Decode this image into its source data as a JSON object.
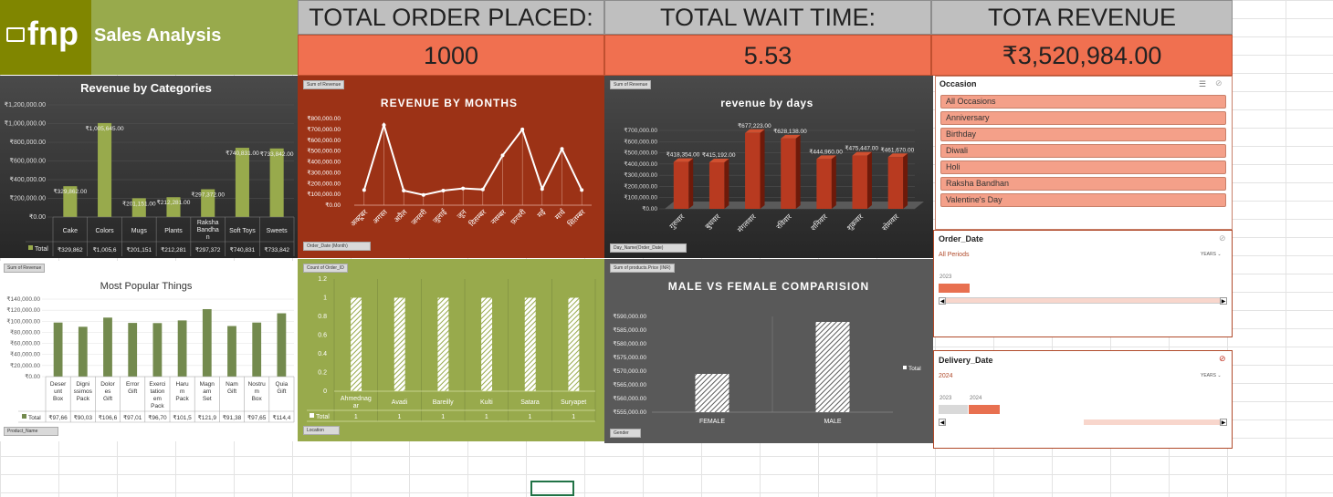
{
  "logo": {
    "brand": "fnp",
    "title": "Sales Analysis"
  },
  "kpis": [
    {
      "title": "TOTAL ORDER PLACED:",
      "value": "1000"
    },
    {
      "title": "TOTAL WAIT TIME:",
      "value": "5.53"
    },
    {
      "title": "TOTA REVENUE",
      "value": "₹3,520,984.00"
    }
  ],
  "colors": {
    "olive": "#98aa4c",
    "darkolive": "#808600",
    "orange": "#f07050",
    "rust": "#9c3216",
    "charcoal": "#3a3a3a"
  },
  "chart_data": [
    {
      "type": "bar",
      "title": "Revenue by Categories",
      "categories": [
        "Cake",
        "Colors",
        "Mugs",
        "Plants",
        "Raksha Bandhan",
        "Soft Toys",
        "Sweets"
      ],
      "series": [
        {
          "name": "Total",
          "values": [
            329862,
            1005645,
            201151,
            212281,
            297372,
            740831,
            733842
          ]
        }
      ],
      "data_labels": [
        "₹329,862.00",
        "₹1,005,645.00",
        "₹201,151.00",
        "₹212,281.00",
        "₹297,372.00",
        "₹740,831.00",
        "₹733,842.00"
      ],
      "table_row": [
        "₹329,862",
        "₹1,005,6",
        "₹201,151",
        "₹212,281",
        "₹297,372",
        "₹740,831",
        "₹733,842"
      ],
      "y_ticks": [
        "₹1,200,000.00",
        "₹1,000,000.00",
        "₹800,000.00",
        "₹600,000.00",
        "₹400,000.00",
        "₹200,000.00",
        "₹0.00"
      ],
      "ylim": [
        0,
        1200000
      ]
    },
    {
      "type": "line",
      "title": "REVENUE BY MONTHS",
      "field_button": "Sum of Revenue",
      "axis_button": "Order_Date (Month)",
      "categories": [
        "अक्टूबर",
        "अगस्त",
        "अप्रैल",
        "जनवरी",
        "जुलाई",
        "जून",
        "दिसम्बर",
        "नवम्बर",
        "फ़रवरी",
        "मई",
        "मार्च",
        "सितम्बर"
      ],
      "values": [
        140000,
        740000,
        135000,
        95000,
        135000,
        155000,
        145000,
        460000,
        700000,
        150000,
        520000,
        140000
      ],
      "y_ticks": [
        "₹800,000.00",
        "₹700,000.00",
        "₹600,000.00",
        "₹500,000.00",
        "₹400,000.00",
        "₹300,000.00",
        "₹200,000.00",
        "₹100,000.00",
        "₹0.00"
      ],
      "ylim": [
        0,
        800000
      ]
    },
    {
      "type": "bar",
      "title": "revenue by days",
      "field_button": "Sum of Revenue",
      "axis_button": "Day_Name(Order_Date)",
      "categories": [
        "गुरुवार",
        "बुधवार",
        "मंगलवार",
        "रविवार",
        "शनिवार",
        "शुक्रवार",
        "सोमवार"
      ],
      "values": [
        418354,
        415192,
        677223,
        628138,
        444960,
        475447,
        461670
      ],
      "data_labels": [
        "₹418,354.00",
        "₹415,192.00",
        "₹677,223.00",
        "₹628,138.00",
        "₹444,960.00",
        "₹475,447.00",
        "₹461,670.00"
      ],
      "y_ticks": [
        "₹700,000.00",
        "₹600,000.00",
        "₹500,000.00",
        "₹400,000.00",
        "₹300,000.00",
        "₹200,000.00",
        "₹100,000.00",
        "₹0.00"
      ],
      "ylim": [
        0,
        700000
      ]
    },
    {
      "type": "bar",
      "title": "Most Popular Things",
      "field_button": "Sum of Revenue",
      "axis_button": "Product_Name",
      "categories": [
        "Desert unt Box",
        "Dignissimos Pack",
        "Dolores Gift",
        "Error Gift",
        "Exercitationem Pack",
        "Harum Pack",
        "Magnam Set",
        "Nam Gift",
        "Nostrum Box",
        "Quia Gift"
      ],
      "category_cells": [
        "Deser unt Box",
        "Digni ssimos Pack",
        "Dolor es Gift",
        "Error Gift",
        "Exerci tation em Pack",
        "Haru m Pack",
        "Magn am Set",
        "Nam Gift",
        "Nostru m Box",
        "Quia Gift"
      ],
      "series": [
        {
          "name": "Total",
          "values": [
            97660,
            90030,
            106600,
            97010,
            96700,
            101500,
            121900,
            91380,
            97650,
            114400
          ]
        }
      ],
      "table_row": [
        "₹97,66",
        "₹90,03",
        "₹106,6",
        "₹97,01",
        "₹96,70",
        "₹101,5",
        "₹121,9",
        "₹91,38",
        "₹97,65",
        "₹114,4"
      ],
      "y_ticks": [
        "₹140,000.00",
        "₹120,000.00",
        "₹100,000.00",
        "₹80,000.00",
        "₹60,000.00",
        "₹40,000.00",
        "₹20,000.00",
        "₹0.00"
      ],
      "ylim": [
        0,
        140000
      ]
    },
    {
      "type": "bar",
      "field_button": "Count of Order_ID",
      "axis_button": "Location",
      "categories": [
        "Ahmednagar",
        "Avadi",
        "Bareilly",
        "Kulti",
        "Satara",
        "Suryapet"
      ],
      "category_cells": [
        "Ahmednag ar",
        "Avadi",
        "Bareilly",
        "Kulti",
        "Satara",
        "Suryapet"
      ],
      "series": [
        {
          "name": "Total",
          "values": [
            1,
            1,
            1,
            1,
            1,
            1
          ]
        }
      ],
      "table_row": [
        "1",
        "1",
        "1",
        "1",
        "1",
        "1"
      ],
      "y_ticks": [
        "1.2",
        "1",
        "0.8",
        "0.6",
        "0.4",
        "0.2",
        "0"
      ],
      "ylim": [
        0,
        1.2
      ]
    },
    {
      "type": "bar",
      "title": "MALE VS FEMALE COMPARISION",
      "field_button": "Sum of products.Price (INR)",
      "axis_button": "Gender",
      "legend": "Total",
      "categories": [
        "FEMALE",
        "MALE"
      ],
      "values": [
        569000,
        588000
      ],
      "y_ticks": [
        "₹590,000.00",
        "₹585,000.00",
        "₹580,000.00",
        "₹575,000.00",
        "₹570,000.00",
        "₹565,000.00",
        "₹560,000.00",
        "₹555,000.00"
      ],
      "ylim": [
        555000,
        590000
      ]
    }
  ],
  "slicers": {
    "occasion": {
      "title": "Occasion",
      "items": [
        "All Occasions",
        "Anniversary",
        "Birthday",
        "Diwali",
        "Holi",
        "Raksha Bandhan",
        "Valentine's Day"
      ]
    },
    "order_date": {
      "title": "Order_Date",
      "period_label": "All Periods",
      "level": "YEARS",
      "years": [
        "2023"
      ]
    },
    "delivery_date": {
      "title": "Delivery_Date",
      "period_label": "2024",
      "level": "YEARS",
      "years": [
        "2023",
        "2024"
      ]
    }
  }
}
